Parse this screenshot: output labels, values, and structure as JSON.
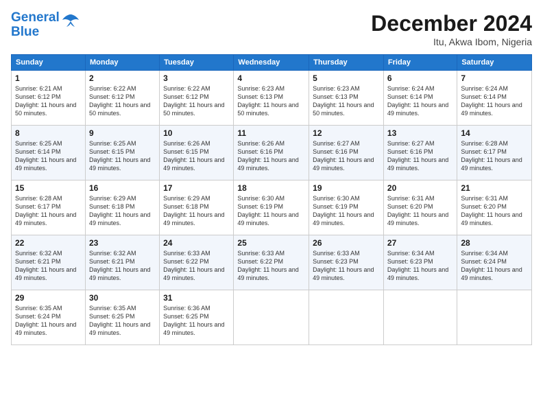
{
  "header": {
    "logo_line1": "General",
    "logo_line2": "Blue",
    "month": "December 2024",
    "location": "Itu, Akwa Ibom, Nigeria"
  },
  "days_of_week": [
    "Sunday",
    "Monday",
    "Tuesday",
    "Wednesday",
    "Thursday",
    "Friday",
    "Saturday"
  ],
  "weeks": [
    [
      {
        "day": "1",
        "sunrise": "6:21 AM",
        "sunset": "6:12 PM",
        "daylight": "11 hours and 50 minutes."
      },
      {
        "day": "2",
        "sunrise": "6:22 AM",
        "sunset": "6:12 PM",
        "daylight": "11 hours and 50 minutes."
      },
      {
        "day": "3",
        "sunrise": "6:22 AM",
        "sunset": "6:12 PM",
        "daylight": "11 hours and 50 minutes."
      },
      {
        "day": "4",
        "sunrise": "6:23 AM",
        "sunset": "6:13 PM",
        "daylight": "11 hours and 50 minutes."
      },
      {
        "day": "5",
        "sunrise": "6:23 AM",
        "sunset": "6:13 PM",
        "daylight": "11 hours and 50 minutes."
      },
      {
        "day": "6",
        "sunrise": "6:24 AM",
        "sunset": "6:14 PM",
        "daylight": "11 hours and 49 minutes."
      },
      {
        "day": "7",
        "sunrise": "6:24 AM",
        "sunset": "6:14 PM",
        "daylight": "11 hours and 49 minutes."
      }
    ],
    [
      {
        "day": "8",
        "sunrise": "6:25 AM",
        "sunset": "6:14 PM",
        "daylight": "11 hours and 49 minutes."
      },
      {
        "day": "9",
        "sunrise": "6:25 AM",
        "sunset": "6:15 PM",
        "daylight": "11 hours and 49 minutes."
      },
      {
        "day": "10",
        "sunrise": "6:26 AM",
        "sunset": "6:15 PM",
        "daylight": "11 hours and 49 minutes."
      },
      {
        "day": "11",
        "sunrise": "6:26 AM",
        "sunset": "6:16 PM",
        "daylight": "11 hours and 49 minutes."
      },
      {
        "day": "12",
        "sunrise": "6:27 AM",
        "sunset": "6:16 PM",
        "daylight": "11 hours and 49 minutes."
      },
      {
        "day": "13",
        "sunrise": "6:27 AM",
        "sunset": "6:16 PM",
        "daylight": "11 hours and 49 minutes."
      },
      {
        "day": "14",
        "sunrise": "6:28 AM",
        "sunset": "6:17 PM",
        "daylight": "11 hours and 49 minutes."
      }
    ],
    [
      {
        "day": "15",
        "sunrise": "6:28 AM",
        "sunset": "6:17 PM",
        "daylight": "11 hours and 49 minutes."
      },
      {
        "day": "16",
        "sunrise": "6:29 AM",
        "sunset": "6:18 PM",
        "daylight": "11 hours and 49 minutes."
      },
      {
        "day": "17",
        "sunrise": "6:29 AM",
        "sunset": "6:18 PM",
        "daylight": "11 hours and 49 minutes."
      },
      {
        "day": "18",
        "sunrise": "6:30 AM",
        "sunset": "6:19 PM",
        "daylight": "11 hours and 49 minutes."
      },
      {
        "day": "19",
        "sunrise": "6:30 AM",
        "sunset": "6:19 PM",
        "daylight": "11 hours and 49 minutes."
      },
      {
        "day": "20",
        "sunrise": "6:31 AM",
        "sunset": "6:20 PM",
        "daylight": "11 hours and 49 minutes."
      },
      {
        "day": "21",
        "sunrise": "6:31 AM",
        "sunset": "6:20 PM",
        "daylight": "11 hours and 49 minutes."
      }
    ],
    [
      {
        "day": "22",
        "sunrise": "6:32 AM",
        "sunset": "6:21 PM",
        "daylight": "11 hours and 49 minutes."
      },
      {
        "day": "23",
        "sunrise": "6:32 AM",
        "sunset": "6:21 PM",
        "daylight": "11 hours and 49 minutes."
      },
      {
        "day": "24",
        "sunrise": "6:33 AM",
        "sunset": "6:22 PM",
        "daylight": "11 hours and 49 minutes."
      },
      {
        "day": "25",
        "sunrise": "6:33 AM",
        "sunset": "6:22 PM",
        "daylight": "11 hours and 49 minutes."
      },
      {
        "day": "26",
        "sunrise": "6:33 AM",
        "sunset": "6:23 PM",
        "daylight": "11 hours and 49 minutes."
      },
      {
        "day": "27",
        "sunrise": "6:34 AM",
        "sunset": "6:23 PM",
        "daylight": "11 hours and 49 minutes."
      },
      {
        "day": "28",
        "sunrise": "6:34 AM",
        "sunset": "6:24 PM",
        "daylight": "11 hours and 49 minutes."
      }
    ],
    [
      {
        "day": "29",
        "sunrise": "6:35 AM",
        "sunset": "6:24 PM",
        "daylight": "11 hours and 49 minutes."
      },
      {
        "day": "30",
        "sunrise": "6:35 AM",
        "sunset": "6:25 PM",
        "daylight": "11 hours and 49 minutes."
      },
      {
        "day": "31",
        "sunrise": "6:36 AM",
        "sunset": "6:25 PM",
        "daylight": "11 hours and 49 minutes."
      },
      null,
      null,
      null,
      null
    ]
  ]
}
